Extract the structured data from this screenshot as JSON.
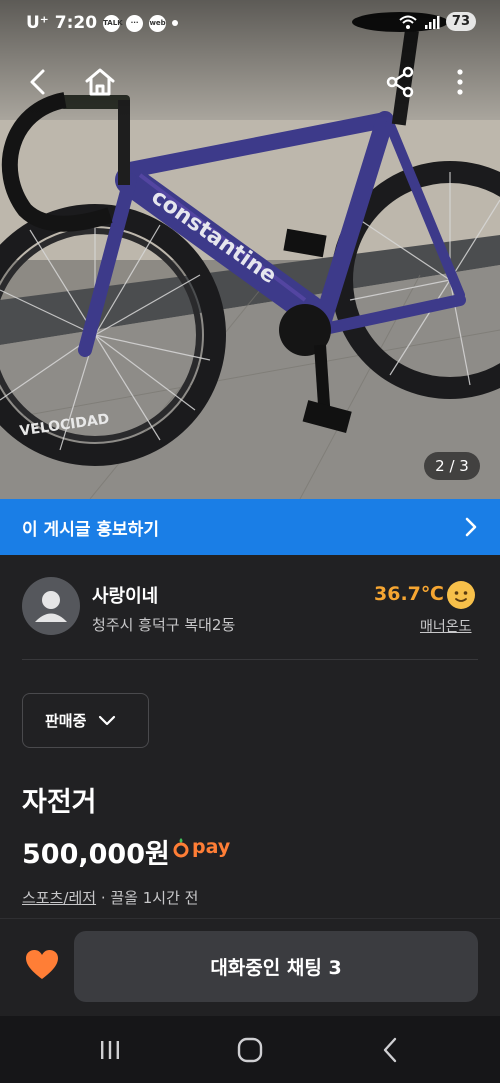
{
  "status_bar": {
    "carrier": "U⁺",
    "time": "7:20",
    "notifications": [
      "talk-icon",
      "chat-icon",
      "web-icon"
    ],
    "battery": "73"
  },
  "photo": {
    "frame_text": "constantine",
    "rim_text": "VELOCIDAD",
    "page_counter": "2 / 3"
  },
  "promo": {
    "label": "이 게시글 홍보하기"
  },
  "seller": {
    "name": "사랑이네",
    "location": "청주시 흥덕구 복대2동",
    "temperature": "36.7℃",
    "manner_label": "매너온도"
  },
  "listing": {
    "status": "판매중",
    "title": "자전거",
    "price": "500,000원",
    "pay_label": "pay",
    "category": "스포츠/레저",
    "bumped": "· 끌올 1시간 전"
  },
  "actions": {
    "chat_label": "대화중인 채팅 3"
  },
  "colors": {
    "accent_orange": "#ff7e36",
    "temp_orange": "#f6a632",
    "promo_blue": "#1a7ee6",
    "background": "#212123"
  }
}
